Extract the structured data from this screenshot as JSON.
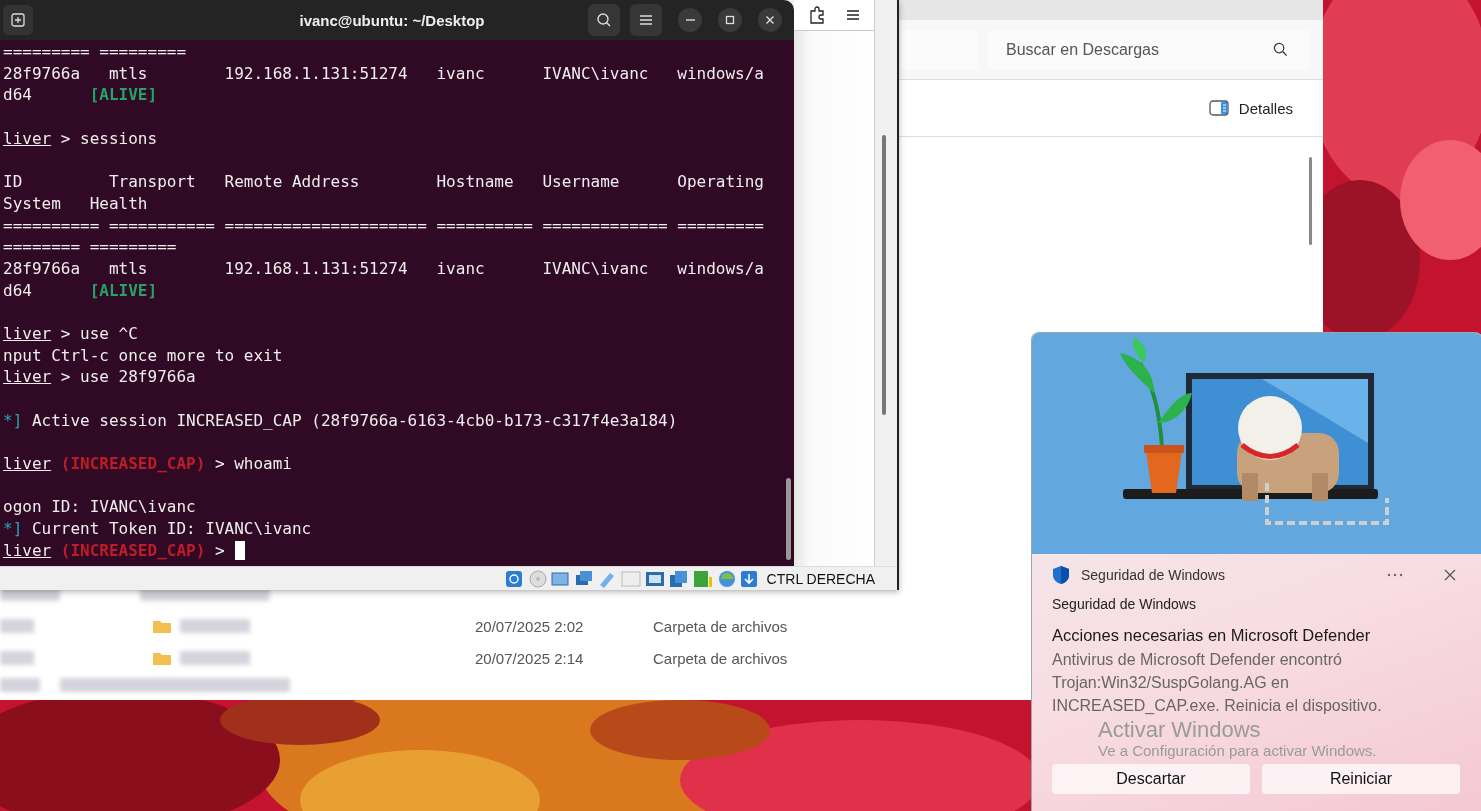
{
  "terminal": {
    "title": "ivanc@ubuntu: ~/Desktop",
    "blocks": [
      [
        [
          {
            "text": "========= =========",
            "kind": "plain"
          }
        ],
        [
          {
            "text": "28f9766a   mtls        192.168.1.131:51274   ivanc      IVANC\\ivanc   windows/a",
            "kind": "plain"
          }
        ],
        [
          {
            "text": "d64      ",
            "kind": "plain"
          },
          {
            "text": "[ALIVE]",
            "kind": "green"
          }
        ]
      ],
      [
        [
          {
            "text": "liver",
            "kind": "prompt"
          },
          {
            "text": " > sessions",
            "kind": "plain"
          }
        ]
      ],
      [
        [
          {
            "text": "ID         Transport   Remote Address        Hostname   Username      Operating",
            "kind": "plain"
          }
        ],
        [
          {
            "text": "System   Health",
            "kind": "plain"
          }
        ],
        [
          {
            "text": "========== =========== ===================== ========== ============= =========",
            "kind": "plain"
          }
        ],
        [
          {
            "text": "======== =========",
            "kind": "plain"
          }
        ],
        [
          {
            "text": "28f9766a   mtls        192.168.1.131:51274   ivanc      IVANC\\ivanc   windows/a",
            "kind": "plain"
          }
        ],
        [
          {
            "text": "d64      ",
            "kind": "plain"
          },
          {
            "text": "[ALIVE]",
            "kind": "green"
          }
        ]
      ],
      [
        [
          {
            "text": "liver",
            "kind": "prompt"
          },
          {
            "text": " > use ^C",
            "kind": "plain"
          }
        ],
        [
          {
            "text": "nput Ctrl-c once more to exit",
            "kind": "plain"
          }
        ],
        [
          {
            "text": "liver",
            "kind": "prompt"
          },
          {
            "text": " > use 28f9766a",
            "kind": "plain"
          }
        ]
      ],
      [
        [
          {
            "text": "*]",
            "kind": "cyan"
          },
          {
            "text": " Active session INCREASED_CAP (28f9766a-6163-4cb0-b173-c317f4e3a184)",
            "kind": "plain"
          }
        ]
      ],
      [
        [
          {
            "text": "liver",
            "kind": "prompt"
          },
          {
            "text": " (INCREASED_CAP)",
            "kind": "red"
          },
          {
            "text": " > whoami",
            "kind": "plain"
          }
        ]
      ],
      [
        [
          {
            "text": "ogon ID: IVANC\\ivanc",
            "kind": "plain"
          }
        ],
        [
          {
            "text": "*]",
            "kind": "cyan"
          },
          {
            "text": " Current Token ID: IVANC\\ivanc",
            "kind": "plain"
          }
        ],
        [
          {
            "text": "liver",
            "kind": "prompt"
          },
          {
            "text": " (INCREASED_CAP)",
            "kind": "red"
          },
          {
            "text": " >",
            "kind": "plain"
          }
        ]
      ]
    ]
  },
  "vm_status_bar": {
    "host_key": "CTRL DERECHA"
  },
  "explorer": {
    "search": {
      "placeholder": "Buscar en Descargas"
    },
    "details_button": "Detalles",
    "rows": [
      {
        "date": "20/07/2025 2:02",
        "type": "Carpeta de archivos"
      },
      {
        "date": "20/07/2025 2:14",
        "type": "Carpeta de archivos"
      }
    ]
  },
  "notification": {
    "app": "Seguridad de Windows",
    "sender": "Seguridad de Windows",
    "title": "Acciones necesarias en Microsoft Defender",
    "body": "Antivirus de Microsoft Defender encontró Trojan:Win32/SuspGolang.AG en INCREASED_CAP.exe. Reinicia el dispositivo.",
    "buttons": [
      "Descartar",
      "Reiniciar"
    ]
  },
  "activation_notice": {
    "title": "Activar Windows",
    "subtitle": "Ve a Configuración para activar Windows."
  }
}
